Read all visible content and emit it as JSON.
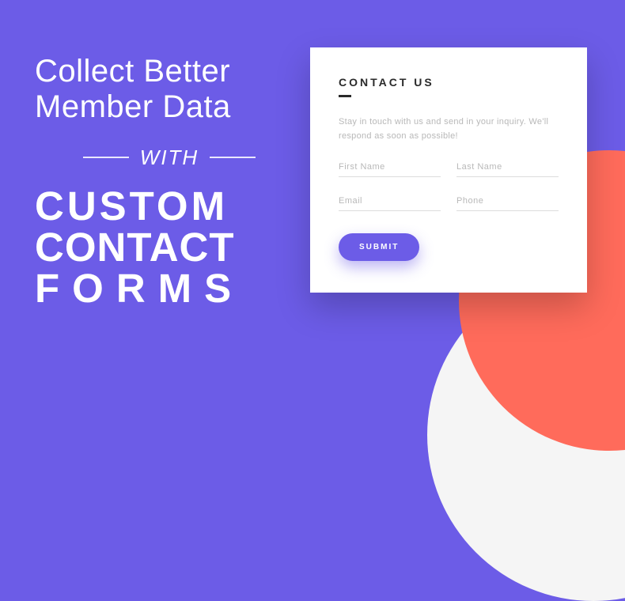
{
  "colors": {
    "primary": "#6c5ce7",
    "coral": "#ff6b5b"
  },
  "headline": {
    "top": "Collect Better Member Data",
    "with": "WITH",
    "bottom_1": "CUSTOM",
    "bottom_2": "CONTACT",
    "bottom_3": "FORMS"
  },
  "form": {
    "title": "CONTACT US",
    "description": "Stay in touch with us and send in your inquiry. We'll respond as soon as possible!",
    "placeholders": {
      "first_name": "First Name",
      "last_name": "Last Name",
      "email": "Email",
      "phone": "Phone"
    },
    "submit_label": "SUBMIT"
  }
}
